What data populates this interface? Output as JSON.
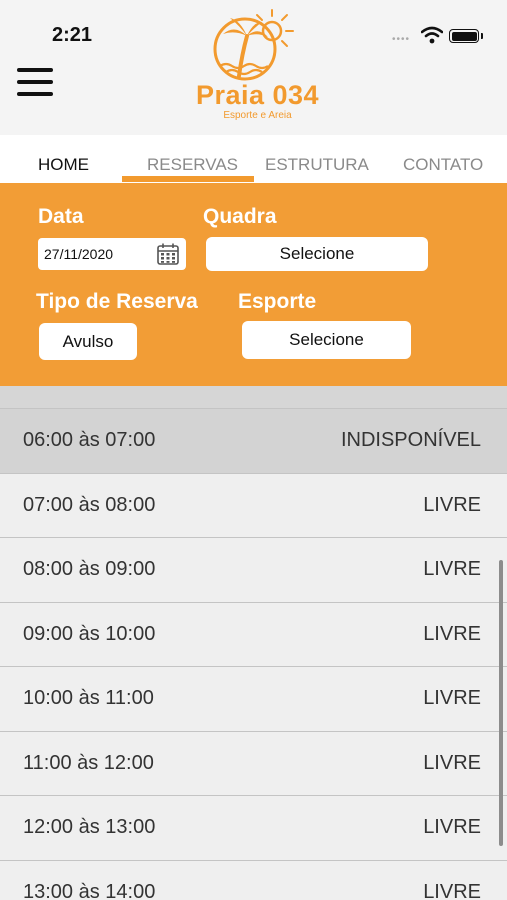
{
  "status_bar": {
    "time": "2:21"
  },
  "colors": {
    "accent": "#f29a2e",
    "panel": "#f29d36"
  },
  "logo": {
    "title": "Praia 034",
    "subtitle": "Esporte e Areia"
  },
  "nav": {
    "tabs": [
      {
        "label": "HOME"
      },
      {
        "label": "RESERVAS"
      },
      {
        "label": "ESTRUTURA"
      },
      {
        "label": "CONTATO"
      }
    ]
  },
  "form": {
    "date_label": "Data",
    "date_value": "27/11/2020",
    "court_label": "Quadra",
    "court_value": "Selecione",
    "type_label": "Tipo de Reserva",
    "type_value": "Avulso",
    "sport_label": "Esporte",
    "sport_value": "Selecione"
  },
  "slots": [
    {
      "time": "06:00 às 07:00",
      "status": "INDISPONÍVEL"
    },
    {
      "time": "07:00 às 08:00",
      "status": "LIVRE"
    },
    {
      "time": "08:00 às 09:00",
      "status": "LIVRE"
    },
    {
      "time": "09:00 às 10:00",
      "status": "LIVRE"
    },
    {
      "time": "10:00 às 11:00",
      "status": "LIVRE"
    },
    {
      "time": "11:00 às 12:00",
      "status": "LIVRE"
    },
    {
      "time": "12:00 às 13:00",
      "status": "LIVRE"
    },
    {
      "time": "13:00 às 14:00",
      "status": "LIVRE"
    }
  ]
}
